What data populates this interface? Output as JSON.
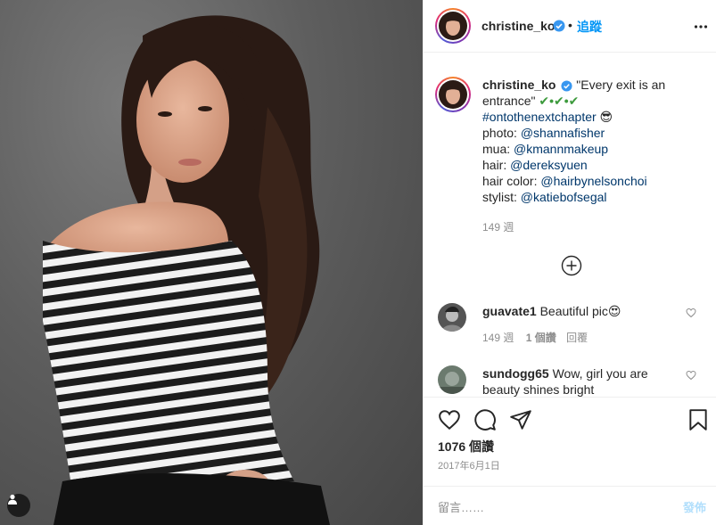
{
  "post": {
    "username": "christine_ko",
    "follow_label": "追蹤",
    "separator": "•"
  },
  "caption": {
    "username": "christine_ko",
    "line1": "\"Every exit is an entrance\"",
    "checks": "✔•✔•✔",
    "hashtag": "#ontothenextchapter",
    "emoji": "😎",
    "photo_label": "photo:",
    "photo_link": "@shannafisher",
    "mua_label": "mua:",
    "mua_link": "@kmannmakeup",
    "hair_label": "hair:",
    "hair_link": "@dereksyuen",
    "haircolor_label": "hair color:",
    "haircolor_link": "@hairbynelsonchoi",
    "stylist_label": "stylist:",
    "stylist_link": "@katiebofsegal",
    "age": "149 週"
  },
  "comments": [
    {
      "username": "guavate1",
      "text": "Beautiful pic",
      "emoji": "😍",
      "age": "149 週",
      "likes": "1 個讚",
      "reply": "回覆"
    },
    {
      "username": "sundogg65",
      "text": "Wow, girl you are beauty shines bright",
      "emoji": ""
    }
  ],
  "stats": {
    "likes": "1076 個讚",
    "date": "2017年6月1日"
  },
  "add_comment": {
    "placeholder": "留言……",
    "post_label": "發佈"
  },
  "icons": {
    "verified": "verified-badge-icon",
    "more": "more-options-icon",
    "load_more": "plus-circle-icon",
    "like": "heart-icon",
    "comment": "comment-icon",
    "share": "share-icon",
    "save": "bookmark-icon",
    "tag": "user-tag-icon"
  },
  "colors": {
    "accent": "#0095f6",
    "link": "#00376b",
    "muted": "#8e8e8e",
    "verified": "#3897f0"
  }
}
